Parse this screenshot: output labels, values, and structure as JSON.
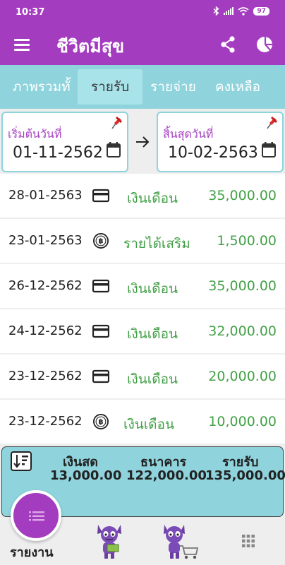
{
  "status_bar": {
    "time": "10:37",
    "battery": "97"
  },
  "app_bar": {
    "title": "ชีวิตมีสุข"
  },
  "tabs": [
    {
      "label": "ภาพรวมทั้",
      "active": false
    },
    {
      "label": "รายรับ",
      "active": true
    },
    {
      "label": "รายจ่าย",
      "active": false
    },
    {
      "label": "คงเหลือ",
      "active": false
    }
  ],
  "date_range": {
    "start": {
      "label": "เริ่มต้นวันที่",
      "value": "01-11-2562"
    },
    "end": {
      "label": "สิ้นสุดวันที่",
      "value": "10-02-2563"
    }
  },
  "transactions": [
    {
      "date": "28-01-2563",
      "icon": "credit-card-icon",
      "category": "เงินเดือน",
      "amount": "35,000.00"
    },
    {
      "date": "23-01-2563",
      "icon": "baht-coin-icon",
      "category": "รายได้เสริม",
      "amount": "1,500.00"
    },
    {
      "date": "26-12-2562",
      "icon": "credit-card-icon",
      "category": "เงินเดือน",
      "amount": "35,000.00"
    },
    {
      "date": "24-12-2562",
      "icon": "credit-card-icon",
      "category": "เงินเดือน",
      "amount": "32,000.00"
    },
    {
      "date": "23-12-2562",
      "icon": "credit-card-icon",
      "category": "เงินเดือน",
      "amount": "20,000.00"
    },
    {
      "date": "23-12-2562",
      "icon": "baht-coin-icon",
      "category": "เงินเดือน",
      "amount": "10,000.00"
    }
  ],
  "summary": {
    "cash_label": "เงินสด",
    "cash_value": "13,000.00",
    "bank_label": "ธนาคาร",
    "bank_value": "122,000.00",
    "income_label": "รายรับ",
    "income_value": "135,000.00"
  },
  "bottom_nav": {
    "report_label": "รายงาน"
  },
  "colors": {
    "primary": "#a43cc0",
    "accent": "#8fd3dc",
    "income_text": "#43a047"
  }
}
